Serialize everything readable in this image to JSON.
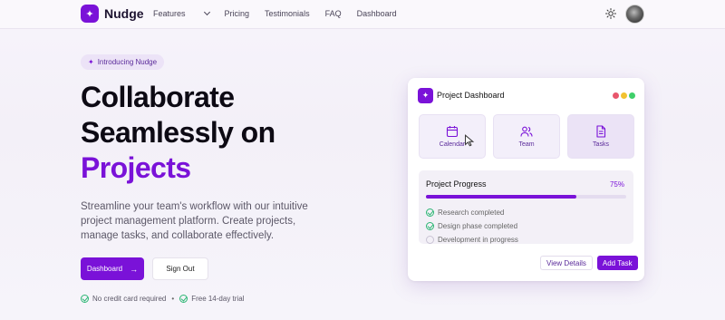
{
  "brand": {
    "name": "Nudge",
    "accent": "#7a12d8"
  },
  "nav": {
    "links": [
      {
        "label": "Features",
        "has_dropdown": true
      },
      {
        "label": "Pricing"
      },
      {
        "label": "Testimonials"
      },
      {
        "label": "FAQ"
      },
      {
        "label": "Dashboard"
      }
    ],
    "theme_icon": "sun-icon"
  },
  "hero": {
    "badge": "Introducing Nudge",
    "title_line1": "Collaborate",
    "title_line2": "Seamlessly on",
    "title_accent": "Projects",
    "description": "Streamline your team's workflow with our intuitive project management platform. Create projects, manage tasks, and collaborate effectively.",
    "primary_button": "Dashboard",
    "secondary_button": "Sign Out",
    "perks": [
      "No credit card required",
      "Free 14-day trial"
    ]
  },
  "card": {
    "title": "Project Dashboard",
    "window_dots": [
      "#e8566c",
      "#f2c230",
      "#3fcf6a"
    ],
    "tiles": [
      {
        "label": "Calendar",
        "icon": "calendar-icon"
      },
      {
        "label": "Team",
        "icon": "users-icon"
      },
      {
        "label": "Tasks",
        "icon": "document-icon"
      }
    ],
    "progress": {
      "title": "Project Progress",
      "percent_label": "75%",
      "value": 0.75,
      "steps": [
        {
          "label": "Research completed",
          "done": true
        },
        {
          "label": "Design phase completed",
          "done": true
        },
        {
          "label": "Development in progress",
          "done": false
        }
      ]
    },
    "view_button": "View Details",
    "add_button": "Add Task"
  }
}
